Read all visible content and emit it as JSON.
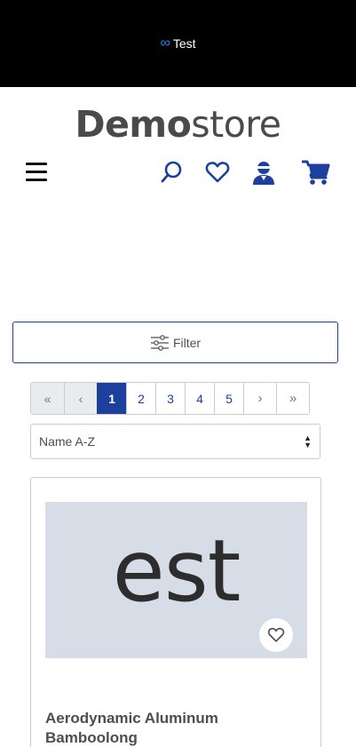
{
  "topbar": {
    "symbol": "∞",
    "label": "Test"
  },
  "logo": {
    "bold": "Demo",
    "light": "store"
  },
  "header_icons": [
    "menu-icon",
    "search-icon",
    "heart-icon",
    "account-icon",
    "cart-icon"
  ],
  "colors": {
    "accent": "#1d3f9e",
    "topbar_bg": "#000000",
    "infinity": "#1e88e5"
  },
  "filter": {
    "label": "Filter",
    "icon": "sliders-icon"
  },
  "pagination": {
    "first": "«",
    "prev": "‹",
    "pages": [
      "1",
      "2",
      "3",
      "4",
      "5"
    ],
    "active_page": "1",
    "next": "›",
    "last": "»"
  },
  "sort": {
    "selected": "Name A-Z"
  },
  "product": {
    "image_text": "est",
    "name": "Aerodynamic Aluminum Bamboolong"
  }
}
